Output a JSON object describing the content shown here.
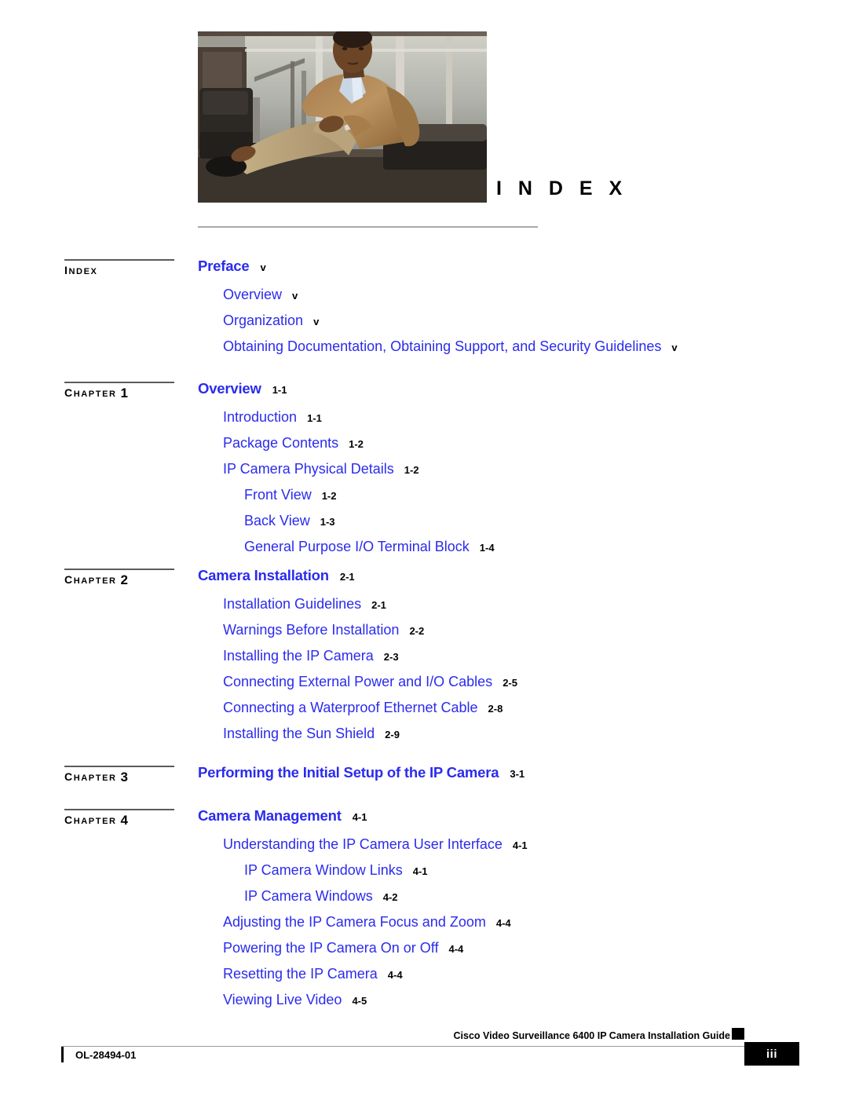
{
  "page": {
    "heading": "I N D E X",
    "photo_alt": "seated-man-photo"
  },
  "toc": [
    {
      "label_kind": "index",
      "label_first": "I",
      "label_rest": "NDEX",
      "label_num": "",
      "entries": [
        {
          "level": 0,
          "title": "Preface",
          "page": "v"
        },
        {
          "level": 1,
          "title": "Overview",
          "page": "v"
        },
        {
          "level": 1,
          "title": "Organization",
          "page": "v"
        },
        {
          "level": 1,
          "title": "Obtaining Documentation, Obtaining Support, and Security Guidelines",
          "page": "v"
        }
      ]
    },
    {
      "label_kind": "chapter",
      "label_first": "C",
      "label_rest": "HAPTER",
      "label_num": "1",
      "entries": [
        {
          "level": 0,
          "title": "Overview",
          "page": "1-1"
        },
        {
          "level": 1,
          "title": "Introduction",
          "page": "1-1"
        },
        {
          "level": 1,
          "title": "Package Contents",
          "page": "1-2"
        },
        {
          "level": 1,
          "title": "IP Camera Physical Details",
          "page": "1-2"
        },
        {
          "level": 2,
          "title": "Front View",
          "page": "1-2"
        },
        {
          "level": 2,
          "title": "Back View",
          "page": "1-3"
        },
        {
          "level": 2,
          "title": "General Purpose I/O Terminal Block",
          "page": "1-4"
        }
      ]
    },
    {
      "label_kind": "chapter",
      "label_first": "C",
      "label_rest": "HAPTER",
      "label_num": "2",
      "entries": [
        {
          "level": 0,
          "title": "Camera Installation",
          "page": "2-1"
        },
        {
          "level": 1,
          "title": "Installation Guidelines",
          "page": "2-1"
        },
        {
          "level": 1,
          "title": "Warnings Before Installation",
          "page": "2-2"
        },
        {
          "level": 1,
          "title": "Installing the IP Camera",
          "page": "2-3"
        },
        {
          "level": 1,
          "title": "Connecting External Power and I/O Cables",
          "page": "2-5"
        },
        {
          "level": 1,
          "title": "Connecting a Waterproof Ethernet Cable",
          "page": "2-8"
        },
        {
          "level": 1,
          "title": "Installing the Sun Shield",
          "page": "2-9"
        }
      ]
    },
    {
      "label_kind": "chapter",
      "label_first": "C",
      "label_rest": "HAPTER",
      "label_num": "3",
      "entries": [
        {
          "level": 0,
          "title": "Performing the Initial Setup of the IP Camera",
          "page": "3-1"
        }
      ]
    },
    {
      "label_kind": "chapter",
      "label_first": "C",
      "label_rest": "HAPTER",
      "label_num": "4",
      "entries": [
        {
          "level": 0,
          "title": "Camera Management",
          "page": "4-1"
        },
        {
          "level": 1,
          "title": "Understanding the IP Camera User Interface",
          "page": "4-1"
        },
        {
          "level": 2,
          "title": "IP Camera Window Links",
          "page": "4-1"
        },
        {
          "level": 2,
          "title": "IP Camera Windows",
          "page": "4-2"
        },
        {
          "level": 1,
          "title": "Adjusting the IP Camera Focus and Zoom",
          "page": "4-4"
        },
        {
          "level": 1,
          "title": "Powering the IP Camera On or Off",
          "page": "4-4"
        },
        {
          "level": 1,
          "title": "Resetting the IP Camera",
          "page": "4-4"
        },
        {
          "level": 1,
          "title": "Viewing Live Video",
          "page": "4-5"
        }
      ]
    }
  ],
  "footer": {
    "guide_title": "Cisco Video Surveillance 6400 IP Camera Installation Guide",
    "doc_id": "OL-28494-01",
    "page_number": "iii"
  },
  "colors": {
    "link_blue": "#2b2bee",
    "rule_gray": "#a9a9a9",
    "label_rule": "#5b5b5b",
    "black": "#000000"
  }
}
